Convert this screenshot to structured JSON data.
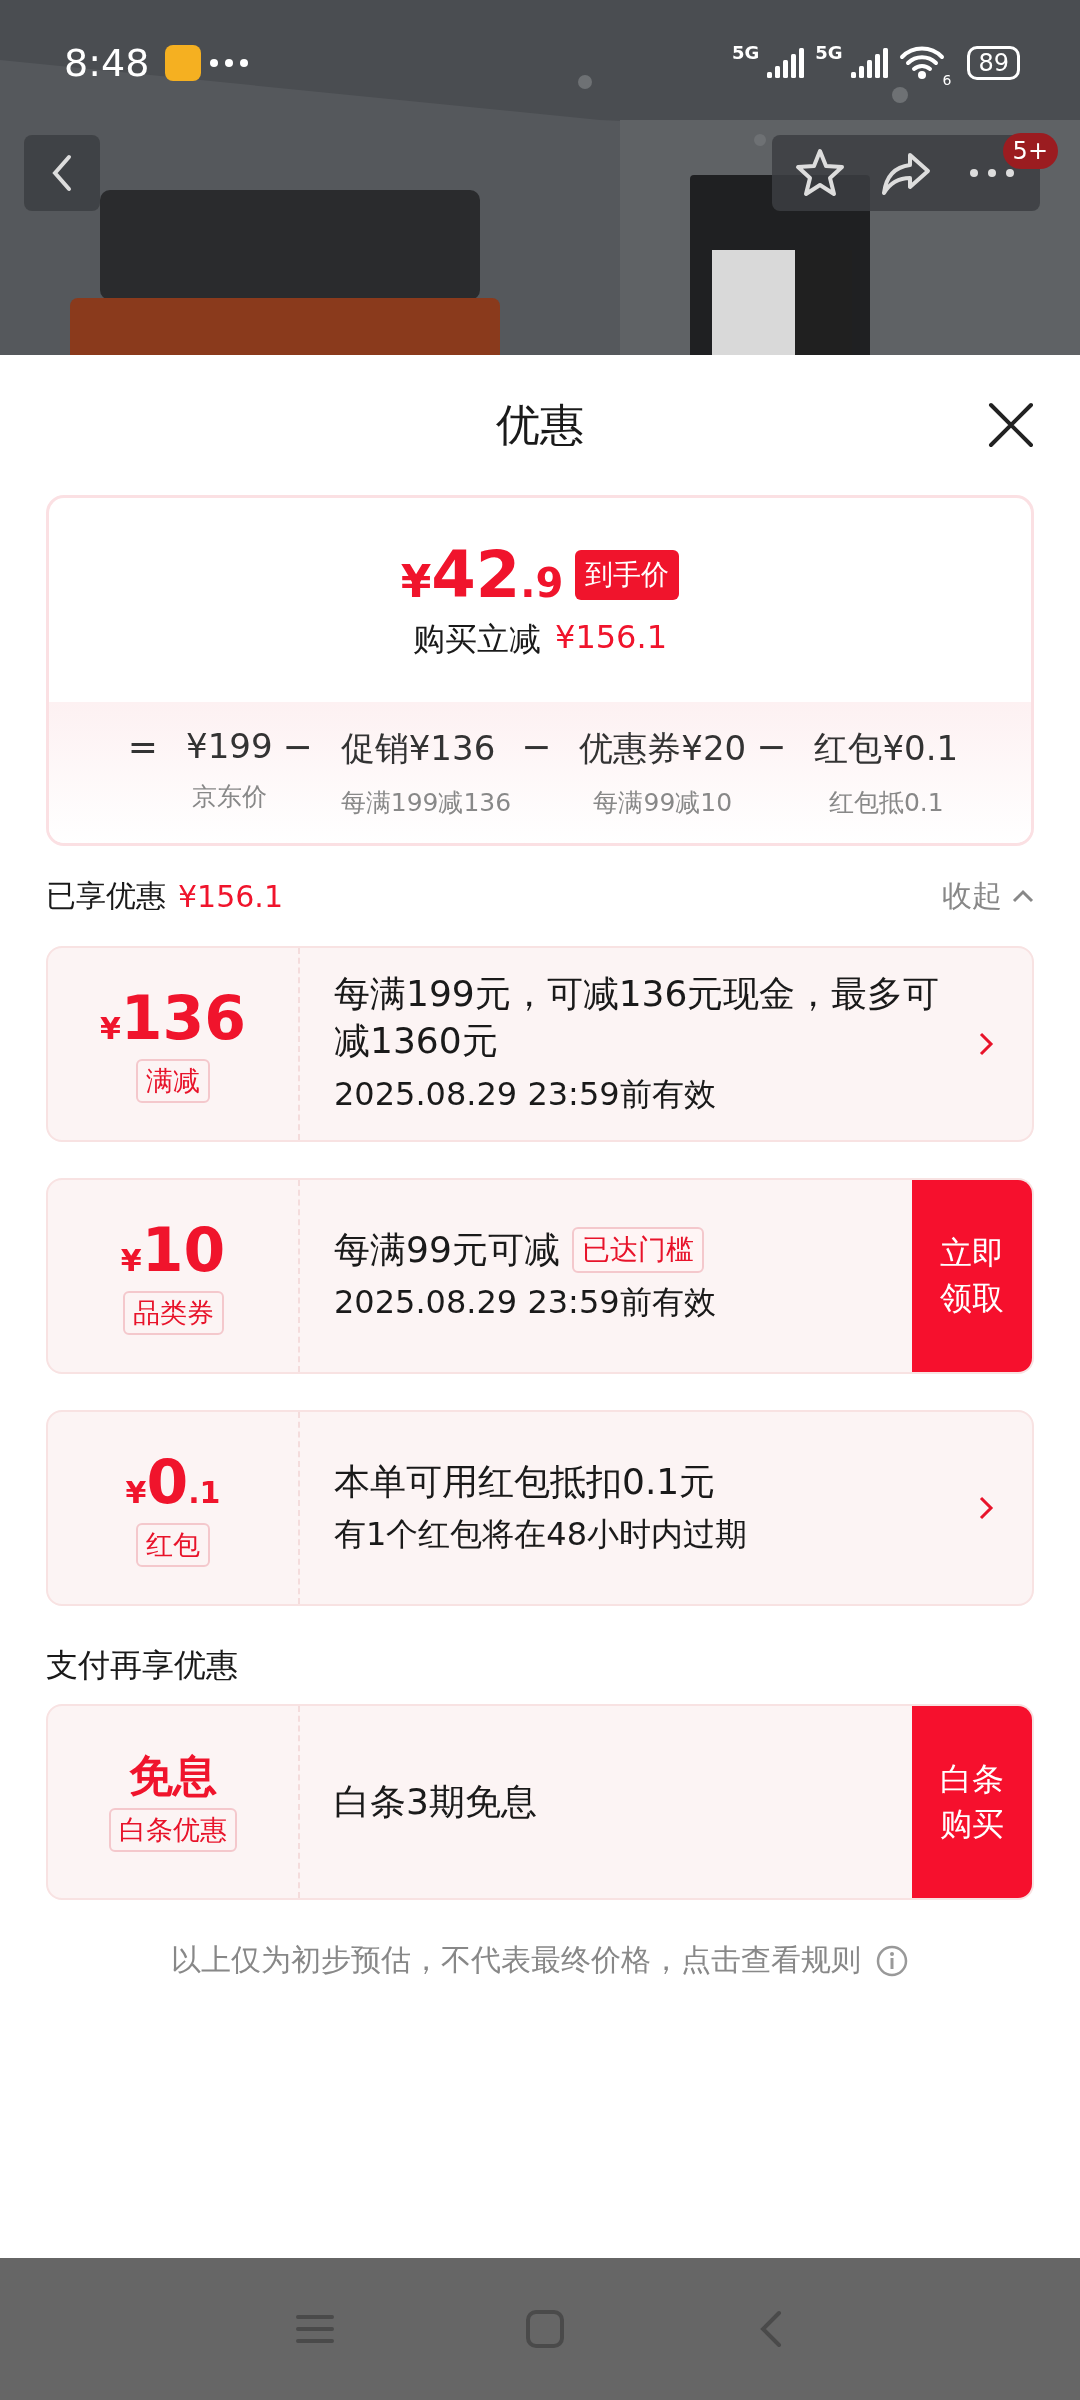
{
  "status_bar": {
    "time": "8:48",
    "networks": [
      "5G",
      "5G"
    ],
    "wifi": "6",
    "battery": "89"
  },
  "top_bar": {
    "badge": "5+"
  },
  "sheet": {
    "title": "优惠"
  },
  "price_card": {
    "symbol": "¥",
    "price_int": "42",
    "price_dec": ".9",
    "price_tag": "到手价",
    "saving_label": "购买立减",
    "saving": "¥156.1",
    "breakdown": [
      {
        "op": "=",
        "amount": "¥199",
        "note": "京东价"
      },
      {
        "op": "−",
        "label": "促销",
        "amount": "¥136",
        "note": "每满199减136"
      },
      {
        "op": "−",
        "label": "优惠券",
        "amount": "¥20",
        "note": "每满99减10"
      },
      {
        "op": "−",
        "label": "红包",
        "amount": "¥0.1",
        "note": "红包抵0.1"
      }
    ]
  },
  "enjoyed": {
    "label": "已享优惠",
    "amount": "¥156.1",
    "toggle": "收起",
    "expanded": true
  },
  "coupons": [
    {
      "kind": "arrow",
      "symbol": "¥",
      "value": "136",
      "tag": "满减",
      "title": "每满199元，可减136元现金，最多可减1360元",
      "subtitle": "2025.08.29 23:59前有效"
    },
    {
      "kind": "button",
      "symbol": "¥",
      "value": "10",
      "tag": "品类券",
      "title": "每满99元可减",
      "badge": "已达门槛",
      "subtitle": "2025.08.29 23:59前有效",
      "action": "立即领取"
    },
    {
      "kind": "arrow",
      "symbol": "¥",
      "value": "0",
      "decimal": ".1",
      "tag": "红包",
      "title": "本单可用红包抵扣0.1元",
      "subtitle": "有1个红包将在48小时内过期"
    }
  ],
  "pay_section": {
    "title": "支付再享优惠",
    "coupons": [
      {
        "kind": "button",
        "value": "免息",
        "tag": "白条优惠",
        "title": "白条3期免息",
        "action": "白条购买"
      }
    ]
  },
  "footer": {
    "text": "以上仅为初步预估，不代表最终价格，点击查看规则"
  }
}
